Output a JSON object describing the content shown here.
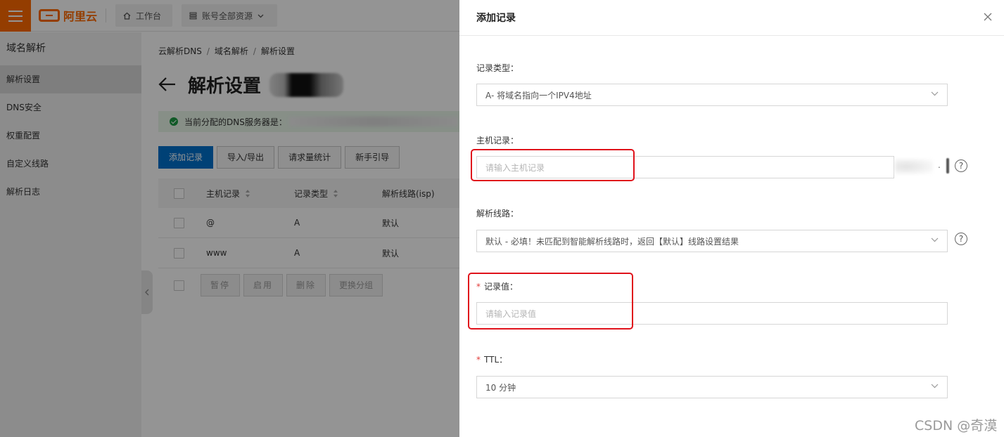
{
  "topbar": {
    "logo_text": "阿里云",
    "workbench_label": "工作台",
    "resource_label": "账号全部资源"
  },
  "sidebar": {
    "title": "域名解析",
    "items": [
      {
        "label": "解析设置",
        "active": true
      },
      {
        "label": "DNS安全"
      },
      {
        "label": "权重配置"
      },
      {
        "label": "自定义线路"
      },
      {
        "label": "解析日志"
      }
    ]
  },
  "main": {
    "breadcrumb": [
      "云解析DNS",
      "域名解析",
      "解析设置"
    ],
    "page_title": "解析设置",
    "notice_text": "当前分配的DNS服务器是：",
    "toolbar": {
      "add_record": "添加记录",
      "import_export": "导入/导出",
      "request_stats": "请求量统计",
      "guide": "新手引导"
    },
    "table": {
      "headers": [
        "主机记录",
        "记录类型",
        "解析线路(isp)"
      ],
      "rows": [
        {
          "host": "@",
          "type": "A",
          "line": "默认"
        },
        {
          "host": "www",
          "type": "A",
          "line": "默认"
        }
      ]
    },
    "batch": {
      "pause": "暂停",
      "enable": "启用",
      "delete": "删除",
      "change_group": "更换分组"
    }
  },
  "drawer": {
    "title": "添加记录",
    "record_type": {
      "label": "记录类型：",
      "value": "A- 将域名指向一个IPV4地址"
    },
    "host_record": {
      "label": "主机记录：",
      "placeholder": "请输入主机记录",
      "suffix": "."
    },
    "line": {
      "label": "解析线路：",
      "value": "默认 - 必填！未匹配到智能解析线路时，返回【默认】线路设置结果"
    },
    "record_value": {
      "required_mark": "*",
      "label": "记录值：",
      "placeholder": "请输入记录值"
    },
    "ttl": {
      "required_mark": "*",
      "label": "TTL：",
      "value": "10 分钟"
    },
    "help_glyph": "?"
  },
  "watermark": "CSDN @奇漠",
  "colors": {
    "brand": "#ff6a00",
    "primary": "#0070cc",
    "highlight": "#e0121b",
    "success": "#1e9b44"
  }
}
